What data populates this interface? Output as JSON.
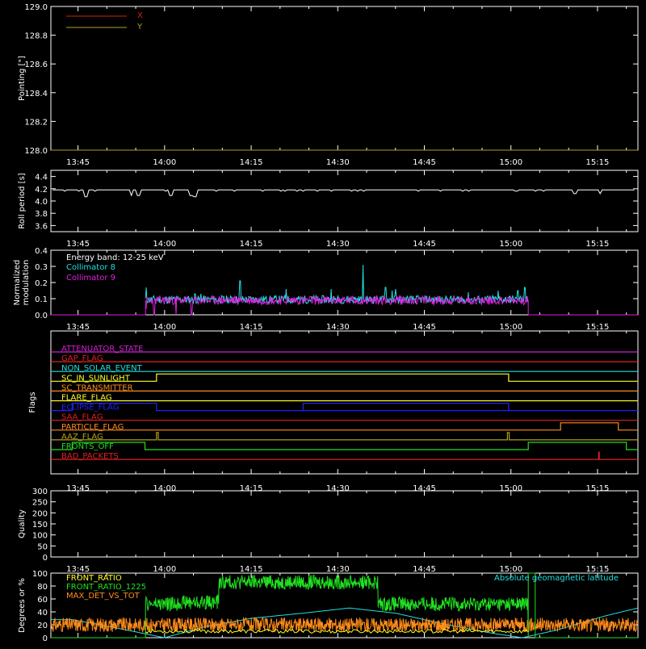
{
  "colors": {
    "background": "#000000",
    "axis": "#ffffff",
    "x_series": "#d81e1e",
    "y_series": "#b0a020",
    "cyan": "#20e0e0",
    "magenta": "#e020e0",
    "green": "#20e020",
    "orange": "#ff8c1a",
    "yellow": "#ffff20",
    "red": "#e02020",
    "blue": "#2020ff",
    "purple": "#d020d0",
    "olive": "#b0a020"
  },
  "time_axis": {
    "range_min": [
      764,
      804
    ],
    "ticks": [
      {
        "label": "13:45",
        "min": 765
      },
      {
        "label": "14:00",
        "min": 780
      },
      {
        "label": "14:15",
        "min": 795
      },
      {
        "label": "14:30",
        "min": 810
      },
      {
        "label": "14:45",
        "min": 825
      },
      {
        "label": "15:00",
        "min": 840
      },
      {
        "label": "15:15",
        "min": 855
      }
    ]
  },
  "chart_data": [
    {
      "type": "line",
      "ylabel": "Pointing [\"]",
      "ylim": [
        128.0,
        129.0
      ],
      "yticks": [
        "128.0",
        "128.2",
        "128.4",
        "128.6",
        "128.8",
        "129.0"
      ],
      "series": [
        {
          "name": "X",
          "values": []
        },
        {
          "name": "Y",
          "values": []
        }
      ]
    },
    {
      "type": "line",
      "ylabel": "Roll period [s]",
      "ylim": [
        3.5,
        4.5
      ],
      "yticks": [
        "3.6",
        "3.8",
        "4.0",
        "4.2",
        "4.4"
      ],
      "series": [
        {
          "name": "",
          "baseline": 4.18,
          "dips": [
            [
              766.5,
              4.07
            ],
            [
              774.3,
              4.09
            ],
            [
              775.5,
              4.09
            ],
            [
              781.0,
              4.09
            ],
            [
              784.5,
              4.09
            ],
            [
              785.3,
              4.07
            ],
            [
              851.0,
              4.12
            ],
            [
              855.5,
              4.12
            ]
          ]
        }
      ]
    },
    {
      "type": "line",
      "title": "Energy band: 12-25 keV",
      "ylabel": "Normalized modulation",
      "ylim": [
        0.0,
        0.4
      ],
      "yticks": [
        "0.0",
        "0.1",
        "0.2",
        "0.3",
        "0.4"
      ],
      "active_window": [
        776.7,
        843.0
      ],
      "series": [
        {
          "name": "Collimator 8",
          "baseline": 0.095,
          "spikes": [
            [
              776.8,
              0.17
            ],
            [
              785.3,
              0.13
            ],
            [
              786.3,
              0.13
            ],
            [
              793.1,
              0.21
            ],
            [
              801.1,
              0.16
            ],
            [
              808.9,
              0.16
            ],
            [
              818.3,
              0.17
            ],
            [
              819.4,
              0.15
            ],
            [
              820.0,
              0.16
            ],
            [
              832.6,
              0.14
            ],
            [
              837.8,
              0.15
            ],
            [
              841.2,
              0.15
            ],
            [
              842.4,
              0.17
            ]
          ],
          "peak": [
            814.4,
            0.31
          ]
        },
        {
          "name": "Collimator 9",
          "baseline": 0.09,
          "dips": [
            [
              776.8,
              0.04
            ],
            [
              778.2,
              0.0
            ],
            [
              782.0,
              0.0
            ],
            [
              784.7,
              0.0
            ]
          ]
        }
      ]
    },
    {
      "type": "table",
      "ylabel": "Flags",
      "flags": [
        {
          "name": "ATTENUATOR_STATE",
          "color": "#d020d0",
          "high": []
        },
        {
          "name": "GAP_FLAG",
          "color": "#e02020",
          "high": []
        },
        {
          "name": "NON_SOLAR_EVENT",
          "color": "#20e0e0",
          "high": []
        },
        {
          "name": "SC_IN_SUNLIGHT",
          "color": "#ffff20",
          "high": [
            [
              778.6,
              839.6
            ]
          ]
        },
        {
          "name": "SC_TRANSMITTER",
          "color": "#ff8c1a",
          "high": []
        },
        {
          "name": "FLARE_FLAG",
          "color": "#ffff20",
          "high": []
        },
        {
          "name": "ECLIPSE_FLAG",
          "color": "#2020ff",
          "high": [
            [
              764,
              778.6
            ],
            [
              839.6,
              804
            ]
          ]
        },
        {
          "name": "SAA_FLAG",
          "color": "#e02020",
          "high": []
        },
        {
          "name": "PARTICLE_FLAG",
          "color": "#ff8c1a",
          "high": [
            [
              848.6,
              858.6
            ]
          ]
        },
        {
          "name": "AAZ_FLAG",
          "color": "#b0a020",
          "high": [
            [
              778.6,
              778.9
            ],
            [
              839.4,
              839.7
            ]
          ]
        },
        {
          "name": "FRONTS_OFF",
          "color": "#20e020",
          "high": [
            [
              764,
              776.6
            ],
            [
              843.0,
              860
            ]
          ]
        },
        {
          "name": "BAD_PACKETS",
          "color": "#e02020",
          "high": [
            [
              855.2,
              855.3
            ]
          ]
        }
      ]
    },
    {
      "type": "line",
      "ylabel": "Quality",
      "ylim": [
        0,
        300
      ],
      "yticks": [
        "0",
        "50",
        "100",
        "150",
        "200",
        "250",
        "300"
      ],
      "series": [
        {
          "name": "",
          "values": []
        }
      ]
    },
    {
      "type": "line",
      "ylabel": "Degrees or %",
      "ylim": [
        0,
        100
      ],
      "yticks": [
        "0",
        "20",
        "40",
        "60",
        "80",
        "100"
      ],
      "series": [
        {
          "name": "FRONT_RATIO",
          "color": "#ffff20"
        },
        {
          "name": "FRONT_RATIO_1225",
          "color": "#20e020",
          "segments": [
            [
              776.7,
              782.4,
              52
            ],
            [
              782.4,
              789.4,
              55
            ],
            [
              789.4,
              803.0,
              86
            ],
            [
              803.0,
              817.0,
              86
            ],
            [
              817.0,
              823.0,
              52
            ],
            [
              823.0,
              843.0,
              52
            ]
          ]
        },
        {
          "name": "MAX_DET_VS_TOT",
          "color": "#ff8c1a",
          "baseline": 20
        },
        {
          "name": "Absolute geomagnetic latitude",
          "color": "#20e0e0",
          "points": [
            [
              764,
              28
            ],
            [
              770,
              18
            ],
            [
              780,
              0
            ],
            [
              787,
              17
            ],
            [
              795,
              30
            ],
            [
              804,
              38
            ],
            [
              812,
              46
            ],
            [
              820,
              38
            ],
            [
              828,
              22
            ],
            [
              836,
              8
            ],
            [
              842,
              0
            ],
            [
              848,
              12
            ],
            [
              856,
              33
            ],
            [
              862,
              46
            ],
            [
              868,
              47
            ],
            [
              875,
              40
            ],
            [
              880,
              34
            ]
          ]
        }
      ]
    }
  ]
}
